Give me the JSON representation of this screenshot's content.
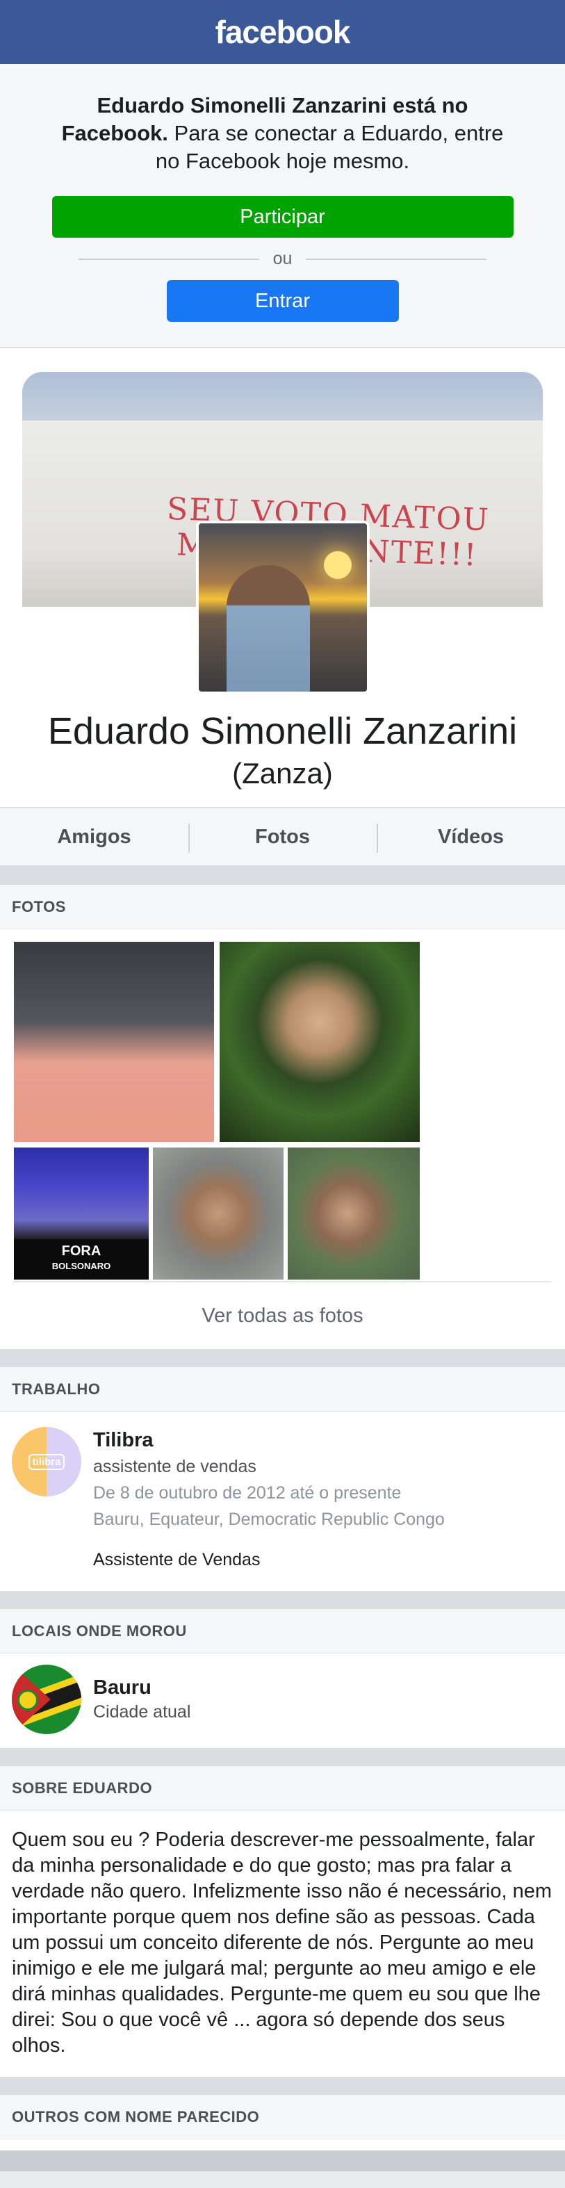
{
  "brand": {
    "logo_text": "facebook",
    "color": "#3b5998"
  },
  "signup": {
    "bold_text": "Eduardo Simonelli Zanzarini está no Facebook.",
    "normal_text": " Para se conectar a Eduardo, entre no Facebook hoje mesmo.",
    "join_label": "Participar",
    "or_label": "ou",
    "login_label": "Entrar",
    "join_color": "#00a400",
    "login_color": "#1877f2"
  },
  "profile": {
    "cover_graffiti": "SEU VOTO MATOU MINHA GENTE!!!",
    "name": "Eduardo Simonelli Zanzarini",
    "nickname": "(Zanza)"
  },
  "tabs": [
    {
      "label": "Amigos"
    },
    {
      "label": "Fotos"
    },
    {
      "label": "Vídeos"
    }
  ],
  "photos": {
    "header": "FOTOS",
    "poster_text_line1": "FORA",
    "poster_text_line2": "BOLSONARO",
    "see_all": "Ver todas as fotos"
  },
  "work": {
    "header": "TRABALHO",
    "logo_text": "tilibra",
    "company": "Tilibra",
    "role": "assistente de vendas",
    "dates": "De 8 de outubro de 2012 até o presente",
    "place": "Bauru, Equateur, Democratic Republic Congo",
    "description": "Assistente de Vendas"
  },
  "places": {
    "header": "LOCAIS ONDE MOROU",
    "name": "Bauru",
    "sub": "Cidade atual"
  },
  "about": {
    "header": "SOBRE EDUARDO",
    "text": "Quem sou eu ? Poderia descrever-me pessoalmente, falar da minha personalidade e do que gosto; mas pra falar a verdade não quero. Infelizmente isso não é necessário, nem importante porque quem nos define são as pessoas. Cada um possui um conceito diferente de nós. Pergunte ao meu inimigo e ele me julgará mal; pergunte ao meu amigo e ele dirá minhas qualidades. Pergunte-me quem eu sou que lhe direi: Sou o que você vê ... agora só de­pende dos seus olhos."
  },
  "others": {
    "header": "OUTROS COM NOME PARECIDO"
  }
}
